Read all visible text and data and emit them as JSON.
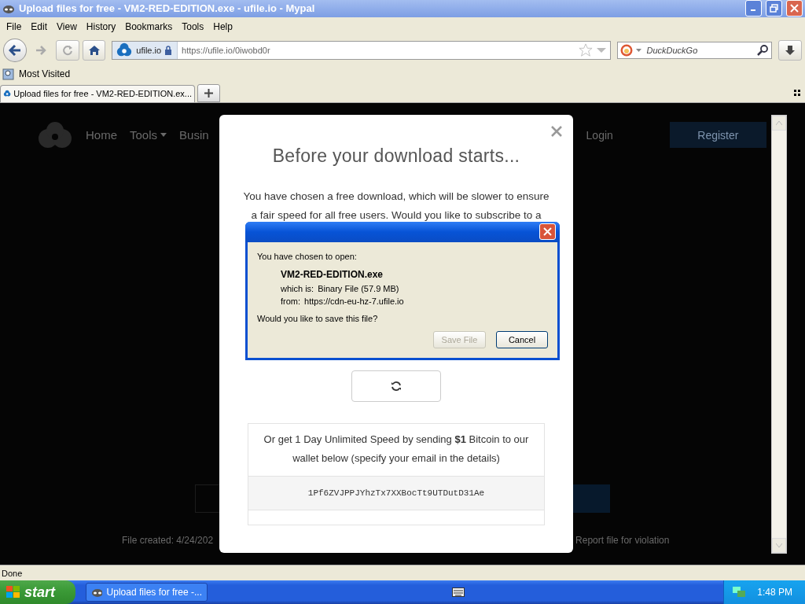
{
  "window": {
    "title": "Upload files for free - VM2-RED-EDITION.exe - ufile.io - Mypal"
  },
  "menu": [
    "File",
    "Edit",
    "View",
    "History",
    "Bookmarks",
    "Tools",
    "Help"
  ],
  "toolbar": {
    "site": "ufile.io",
    "url": "https://ufile.io/0iwobd0r",
    "search": {
      "placeholder": "DuckDuckGo"
    }
  },
  "bookmarks": [
    "Most Visited"
  ],
  "tabs": [
    {
      "label": "Upload files for free - VM2-RED-EDITION.ex...",
      "selected": true
    }
  ],
  "page": {
    "nav": [
      {
        "label": "Home",
        "dropdown": false
      },
      {
        "label": "Tools",
        "dropdown": true
      },
      {
        "label": "Busin",
        "dropdown": false
      }
    ],
    "login": "Login",
    "register": "Register",
    "footer_left": "File created: 4/24/202",
    "footer_right": "Report file for violation"
  },
  "modal": {
    "title": "Before your download starts...",
    "lines": [
      "You have chosen a free download, which will be slower to ensure",
      "a fair speed for all free users. Would you like to subscribe to a"
    ],
    "note": "Or get 1 Day Unlimited Speed by sending **$1** Bitcoin to our wallet below (specify your email in the details)",
    "wallet": "1Pf6ZVJPPJYhzTx7XXBocTt9UTDutD31Ae"
  },
  "file_dialog": {
    "heading": "You have chosen to open:",
    "filename": "VM2-RED-EDITION.exe",
    "type_label": "which is:",
    "type_value": "Binary File (57.9 MB)",
    "from_label": "from:",
    "from_value": "https://cdn-eu-hz-7.ufile.io",
    "question": "Would you like to save this file?",
    "buttons": [
      {
        "label": "Save File",
        "disabled": true
      },
      {
        "label": "Cancel",
        "disabled": false
      }
    ]
  },
  "status_bar": "Done",
  "taskbar": {
    "start": "start",
    "tasks": [
      {
        "label": "Upload files for free -...",
        "selected": false
      }
    ],
    "clock": "1:48 PM"
  }
}
